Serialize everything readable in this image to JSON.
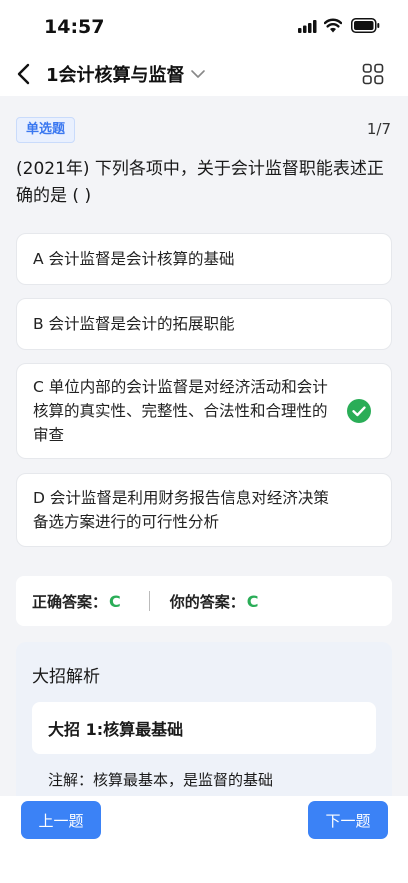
{
  "status": {
    "time": "14:57"
  },
  "nav": {
    "title": "1会计核算与监督"
  },
  "question": {
    "type": "单选题",
    "progress": "1/7",
    "text": "(2021年) 下列各项中，关于会计监督职能表述正确的是 (    )"
  },
  "options": [
    {
      "text": "A 会计监督是会计核算的基础",
      "correct": false
    },
    {
      "text": "B 会计监督是会计的拓展职能",
      "correct": false
    },
    {
      "text": "C 单位内部的会计监督是对经济活动和会计核算的真实性、完整性、合法性和合理性的审查",
      "correct": true
    },
    {
      "text": "D 会计监督是利用财务报告信息对经济决策备选方案进行的可行性分析",
      "correct": false
    }
  ],
  "answer": {
    "correct_label": "正确答案：",
    "correct_value": "C",
    "yours_label": "你的答案：",
    "yours_value": "C"
  },
  "analysis": {
    "title": "大招解析",
    "card": "大招 1:核算最基础",
    "note": "注解：核算最基本，是监督的基础"
  },
  "buttons": {
    "prev": "上一题",
    "next": "下一题"
  },
  "colors": {
    "accent": "#3b82f6",
    "correct": "#2aad57"
  }
}
